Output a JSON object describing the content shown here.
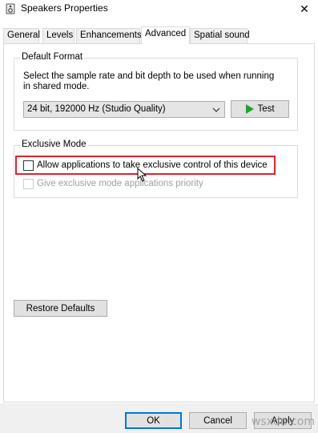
{
  "window": {
    "title": "Speakers Properties",
    "close_glyph": "✕",
    "icon": "speaker-icon"
  },
  "tabs": [
    {
      "label": "General",
      "active": false
    },
    {
      "label": "Levels",
      "active": false
    },
    {
      "label": "Enhancements",
      "active": false
    },
    {
      "label": "Advanced",
      "active": true
    },
    {
      "label": "Spatial sound",
      "active": false
    }
  ],
  "default_format": {
    "group_label": "Default Format",
    "description_line1": "Select the sample rate and bit depth to be used when running",
    "description_line2": "in shared mode.",
    "selected_format": "24 bit, 192000 Hz (Studio Quality)",
    "test_label": "Test"
  },
  "exclusive_mode": {
    "group_label": "Exclusive Mode",
    "allow_label": "Allow applications to take exclusive control of this device",
    "allow_checked": false,
    "priority_label": "Give exclusive mode applications priority",
    "priority_checked": false,
    "priority_enabled": false
  },
  "restore_label": "Restore Defaults",
  "footer": {
    "ok_label": "OK",
    "cancel_label": "Cancel",
    "apply_label": "Apply"
  },
  "watermark": "wsxdn.com",
  "colors": {
    "highlight": "#d7262f",
    "play_icon": "#1fa32c",
    "primary_border": "#0078d7"
  }
}
